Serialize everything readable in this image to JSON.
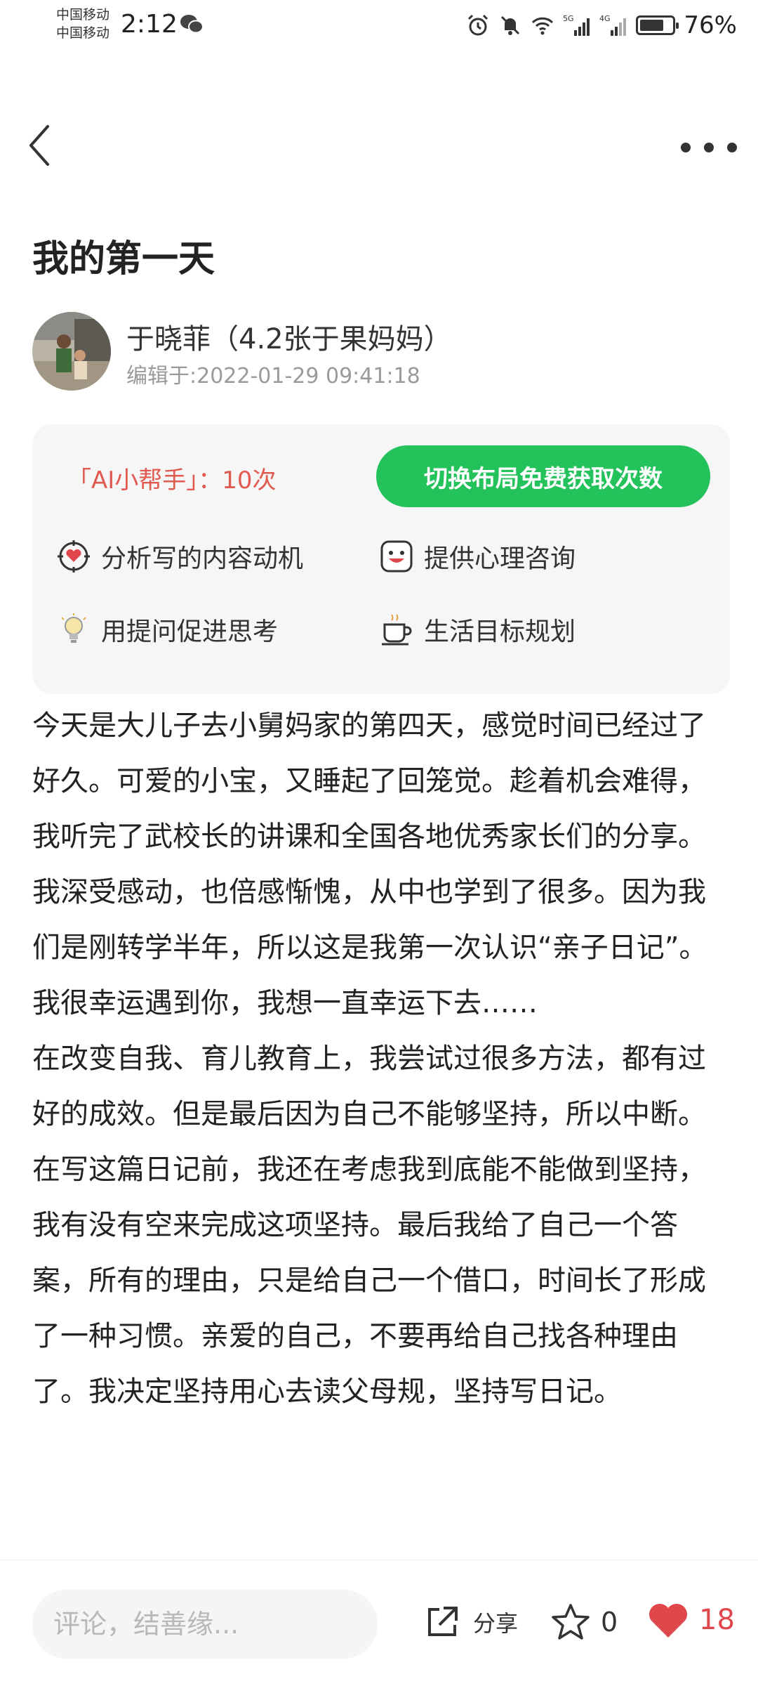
{
  "status_bar": {
    "carrier_1": "中国移动",
    "carrier_2": "中国移动",
    "time": "2:12",
    "battery_percent": "76%",
    "battery_level": 0.76,
    "network_1": "5G",
    "network_2": "4G"
  },
  "post": {
    "title": "我的第一天",
    "author_name": "于晓菲（4.2张于果妈妈）",
    "edited_time": "编辑于:2022-01-29 09:41:18"
  },
  "ai_helper": {
    "count_label": "「AI小帮手」：10次",
    "button_label": "切换布局免费获取次数",
    "features": [
      {
        "label": "分析写的内容动机",
        "icon": "heart-target-icon"
      },
      {
        "label": "提供心理咨询",
        "icon": "smiley-face-icon"
      },
      {
        "label": "用提问促进思考",
        "icon": "lightbulb-icon"
      },
      {
        "label": "生活目标规划",
        "icon": "coffee-cup-icon"
      }
    ],
    "accent_color": "#23c25b",
    "count_color": "#e05a50"
  },
  "body": {
    "paragraph_1": "今天是大儿子去小舅妈家的第四天，感觉时间已经过了好久。可爱的小宝，又睡起了回笼觉。趁着机会难得，我听完了武校长的讲课和全国各地优秀家长们的分享。我深受感动，也倍感惭愧，从中也学到了很多。因为我们是刚转学半年，所以这是我第一次认识“亲子日记”。我很幸运遇到你，我想一直幸运下去……",
    "paragraph_2": "在改变自我、育儿教育上，我尝试过很多方法，都有过好的成效。但是最后因为自己不能够坚持，所以中断。在写这篇日记前，我还在考虑我到底能不能做到坚持，我有没有空来完成这项坚持。最后我给了自己一个答案，所有的理由，只是给自己一个借口，时间长了形成了一种习惯。亲爱的自己，不要再给自己找各种理由了。我决定坚持用心去读父母规，坚持写日记。"
  },
  "bottom_bar": {
    "comment_placeholder": "评论，结善缘...",
    "share_label": "分享",
    "favorite_count": "0",
    "like_count": "18",
    "like_color": "#e0474c"
  }
}
